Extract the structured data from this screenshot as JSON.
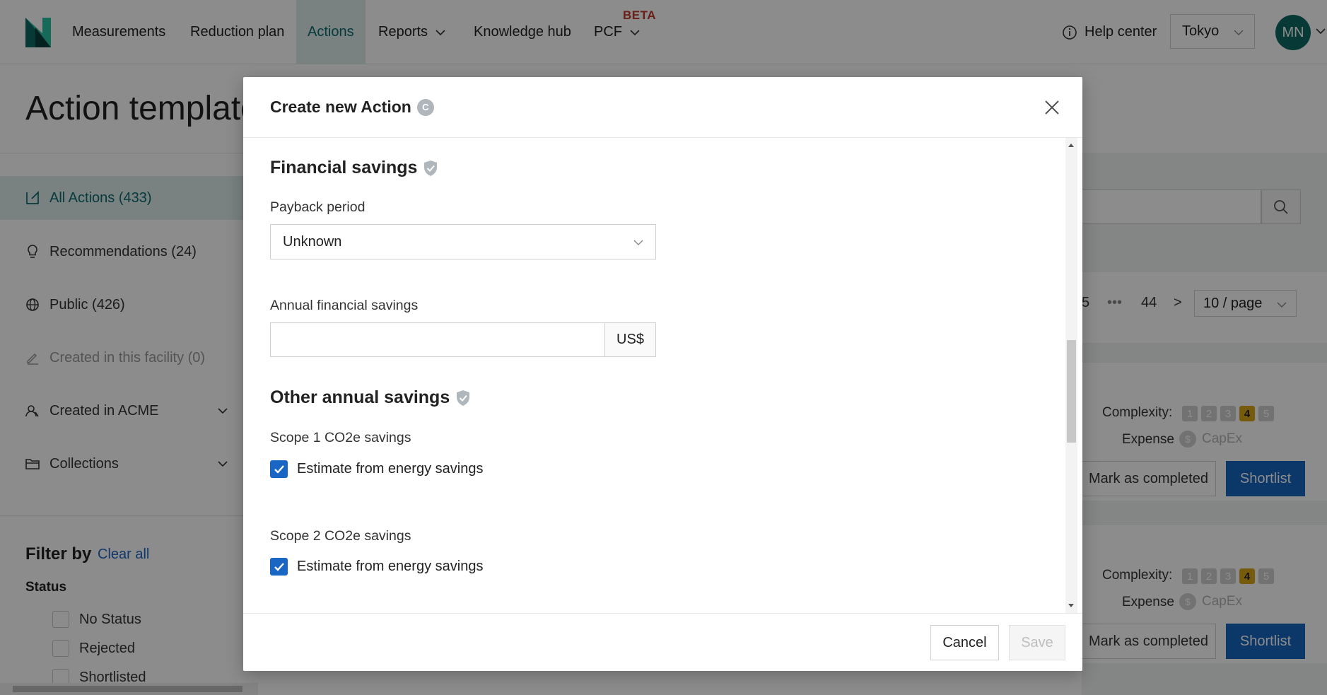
{
  "nav": {
    "items": [
      {
        "label": "Measurements"
      },
      {
        "label": "Reduction plan"
      },
      {
        "label": "Actions"
      },
      {
        "label": "Reports"
      },
      {
        "label": "Knowledge hub"
      },
      {
        "label": "PCF"
      }
    ],
    "pcf_badge": "BETA",
    "help_label": "Help center",
    "location": "Tokyo",
    "avatar_initials": "MN",
    "accent_color": "#0b6b6e"
  },
  "page": {
    "title": "Action templates"
  },
  "sidebar": {
    "items": [
      {
        "label": "All Actions (433)",
        "icon": "logo-icon"
      },
      {
        "label": "Recommendations (24)",
        "icon": "lightbulb-icon"
      },
      {
        "label": "Public (426)",
        "icon": "globe-icon"
      },
      {
        "label": "Created in this facility (0)",
        "icon": "pencil-icon"
      },
      {
        "label": "Created in ACME",
        "icon": "users-icon"
      },
      {
        "label": "Collections",
        "icon": "folder-icon"
      }
    ],
    "filter_title": "Filter by",
    "clear_all": "Clear all",
    "status_label": "Status",
    "status_options": [
      "No Status",
      "Rejected",
      "Shortlisted"
    ]
  },
  "background": {
    "pagination": {
      "five": "5",
      "ellipsis": "•••",
      "last_page": "44",
      "next": ">",
      "page_size": "10 / page"
    },
    "cards": [
      {
        "complexity_label": "Complexity:",
        "complexity_selected": 4,
        "expense_label": "Expense",
        "expense_value": "CapEx",
        "mark_label": "Mark as completed",
        "shortlist_label": "Shortlist"
      },
      {
        "complexity_label": "Complexity:",
        "complexity_selected": 4,
        "expense_label": "Expense",
        "expense_value": "CapEx",
        "mark_label": "Mark as completed",
        "shortlist_label": "Shortlist"
      }
    ],
    "complexity_levels": [
      "1",
      "2",
      "3",
      "4",
      "5"
    ],
    "coin_symbol": "$"
  },
  "modal": {
    "title": "Create new Action",
    "title_badge": "C",
    "financial": {
      "title": "Financial savings",
      "payback_label": "Payback period",
      "payback_value": "Unknown",
      "annual_label": "Annual financial savings",
      "annual_value": "",
      "currency": "US$"
    },
    "other": {
      "title": "Other annual savings",
      "scope1_label": "Scope 1 CO2e savings",
      "scope1_check": "Estimate from energy savings",
      "scope1_checked": true,
      "scope2_label": "Scope 2 CO2e savings",
      "scope2_check": "Estimate from energy savings",
      "scope2_checked": true
    },
    "cancel_label": "Cancel",
    "save_label": "Save",
    "primary_color": "#1a66c4"
  }
}
